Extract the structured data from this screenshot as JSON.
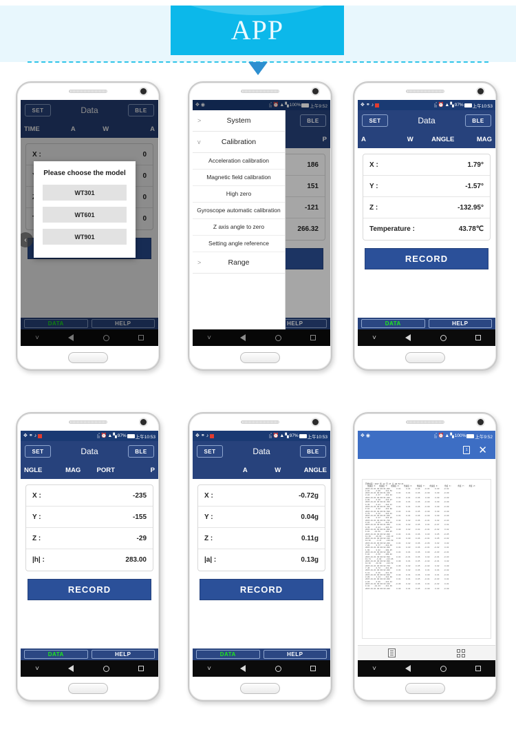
{
  "banner": {
    "title": "APP"
  },
  "common": {
    "set_label": "SET",
    "ble_label": "BLE",
    "app_title": "Data",
    "record_label": "RECORD",
    "data_label": "DATA",
    "help_label": "HELP"
  },
  "phones": [
    {
      "id": "phone-model-dialog",
      "status_bar": {
        "visible": false,
        "time": "",
        "battery": ""
      },
      "tabs": [
        "TIME",
        "A",
        "W",
        "A"
      ],
      "rows": [
        {
          "key": "X :",
          "value": "0"
        },
        {
          "key": "Y :",
          "value": "0"
        },
        {
          "key": "Z :",
          "value": "0"
        },
        {
          "key": "Temperature :",
          "value": "0"
        }
      ],
      "dialog": {
        "title": "Please choose the model",
        "options": [
          "WT301",
          "WT601",
          "WT901"
        ]
      },
      "back_icon": "chevron-left-icon"
    },
    {
      "id": "phone-calibration-menu",
      "status_bar": {
        "visible": true,
        "battery": "100%",
        "time": "上午9:52"
      },
      "tabs": [
        "PORT",
        "P"
      ],
      "rows": [
        {
          "key": "X :",
          "value": "186"
        },
        {
          "key": "Y :",
          "value": "151"
        },
        {
          "key": "Z :",
          "value": "-121"
        },
        {
          "key": "|h| :",
          "value": "266.32"
        }
      ],
      "menu": {
        "groups": [
          {
            "label": "System",
            "expanded": false,
            "marker": ">"
          },
          {
            "label": "Calibration",
            "expanded": true,
            "marker": "v",
            "items": [
              "Acceleration calibration",
              "Magnetic field calibration",
              "High zero",
              "Gyroscope automatic calibration",
              "Z axis angle to zero",
              "Setting angle reference"
            ]
          },
          {
            "label": "Range",
            "expanded": false,
            "marker": ">"
          }
        ]
      }
    },
    {
      "id": "phone-angle-data",
      "status_bar": {
        "visible": true,
        "battery": "97%",
        "time": "上午10:53"
      },
      "tabs": [
        "A",
        "W",
        "ANGLE",
        "MAG"
      ],
      "rows": [
        {
          "key": "X :",
          "value": "1.79°"
        },
        {
          "key": "Y :",
          "value": "-1.57°"
        },
        {
          "key": "Z :",
          "value": "-132.95°"
        },
        {
          "key": "Temperature :",
          "value": "43.78℃"
        }
      ]
    },
    {
      "id": "phone-mag-data",
      "status_bar": {
        "visible": true,
        "battery": "97%",
        "time": "上午10:53"
      },
      "tabs": [
        "NGLE",
        "MAG",
        "PORT",
        "P"
      ],
      "rows": [
        {
          "key": "X :",
          "value": "-235"
        },
        {
          "key": "Y :",
          "value": "-155"
        },
        {
          "key": "Z :",
          "value": "-29"
        },
        {
          "key": "|h| :",
          "value": "283.00"
        }
      ]
    },
    {
      "id": "phone-accel-data",
      "status_bar": {
        "visible": true,
        "battery": "97%",
        "time": "上午10:53"
      },
      "tabs": [
        "",
        "A",
        "W",
        "ANGLE"
      ],
      "rows": [
        {
          "key": "X :",
          "value": "-0.72g"
        },
        {
          "key": "Y :",
          "value": "0.04g"
        },
        {
          "key": "Z :",
          "value": "0.11g"
        },
        {
          "key": "|a| :",
          "value": "0.13g"
        }
      ]
    },
    {
      "id": "phone-log-viewer",
      "status_bar": {
        "visible": true,
        "battery": "100%",
        "time": "上午9:52"
      },
      "toolbar": {
        "copy_icon": "copy-icon",
        "close_icon": "close-icon"
      },
      "bottom_tools": {
        "list_icon": "list-view-icon",
        "grid_icon": "grid-view-icon"
      },
      "log": {
        "header": "开始时间: 2017 年 12 月 27 日 09:52:21",
        "columns": "  加速度 X:   加速度 Y:   加速度 Z:    角速度 X:    角速度 Y:    角速度 Z:      角度 X:      角度 Y:    角度 Z:",
        "lines": [
          "2015-01-01 00:00:01.000      0.01     0.01     0.06    -0.01     0.03    -0.02",
          "8.94     -4.09    -112.58",
          "2015-01-01 00:00:01.100      0.01     0.01     0.06    -0.00     0.00    -0.00",
          "8.82     -3.37    -112.94",
          "2015-01-01 00:00:01.200      0.01     0.01     0.06     0.00     0.00    -0.00",
          "8.99     -3.40    -113.07",
          "2015-01-01 00:00:01.300      0.01     0.01     0.06    -0.00     0.00    -0.00",
          "9.35     -3.81    -113.21",
          "2015-01-01 00:00:01.400      0.01     0.01     0.06    -0.00     0.00    -0.00",
          "9.01     -3.82    -112.98",
          "2015-01-01 00:00:01.500      0.01     0.01     0.05    -0.00     0.00    -0.00",
          "8.79     -3.42    -113.01",
          "2015-01-01 00:00:01.600      0.01     0.01     0.06    -0.00     0.00    -0.00",
          "8.89     -3.27    -113.25",
          "2015-01-01 00:00:01.700      0.02     0.02     0.06    -0.01     0.02    -0.03",
          "8.04     -2.01    -114.43",
          "2015-01-01 00:00:01.800      0.01     0.02     0.05     0.01    -0.07     0.04",
          "9.39     -6.84    -115.41",
          "2015-01-01 00:00:01.900      0.00     0.02     0.04    -0.01    -0.02     0.02",
          "6.01    -16.58    -110.85",
          "2015-01-01 00:00:02.000      0.01     0.01     0.06     0.03     0.05    -0.05",
          "11.39    -16.63    -110.13",
          "2015-01-01 00:00:02.100      0.02     0.00     0.06    -0.01     0.05    -0.02",
          "14.32     -4.17    -116.68",
          "2015-01-01 00:00:02.200      0.01     0.02     0.06    -0.06     0.02     0.02",
          "7.09      0.77    -112.49",
          "2015-01-01 00:00:02.300      0.01     0.03     0.06    -0.01    -0.02     0.01",
          "1.60      0.02    -108.85",
          "2015-01-01 00:00:02.400      0.01     0.01     0.06     0.00    -0.03    -0.01",
          "6.82     -4.50    -109.92",
          "2015-01-01 00:00:02.500      0.01    -0.01     0.06     0.02    -0.01    -0.03",
          "13.71     -6.94    -113.95",
          "2015-01-01 00:00:02.600      0.00     0.01     0.05    -0.02    -0.01     0.02",
          "12.38    -10.68    -113.52",
          "2015-01-01 00:00:02.700      0.06     0.02     0.05    -0.02     0.02     0.00",
          "7.46     -9.72    -111.26",
          "2015-01-01 00:00:02.800      0.01     0.02     0.06     0.01     0.04    -0.02",
          "6.12     -5.49    -111.48",
          "2015-01-01 00:00:02.900      0.02     0.01     0.06     0.00     0.01    -0.01",
          "8.09      1.14    -114.30",
          "2015-01-01 00:00:03.000      0.01     0.01     0.05    -0.01    -0.03     0.01",
          "8.03     -3.36    -113.34",
          "2015-01-01 00:00:03.100     -0.06     0.02     0.06     0.01    -0.02     0.01",
          "9.10    -10.43    -111.39",
          "2015-01-01 00:00:03.200      0.00     0.01     0.05    -0.00     0.03    -0.00"
        ]
      }
    }
  ]
}
